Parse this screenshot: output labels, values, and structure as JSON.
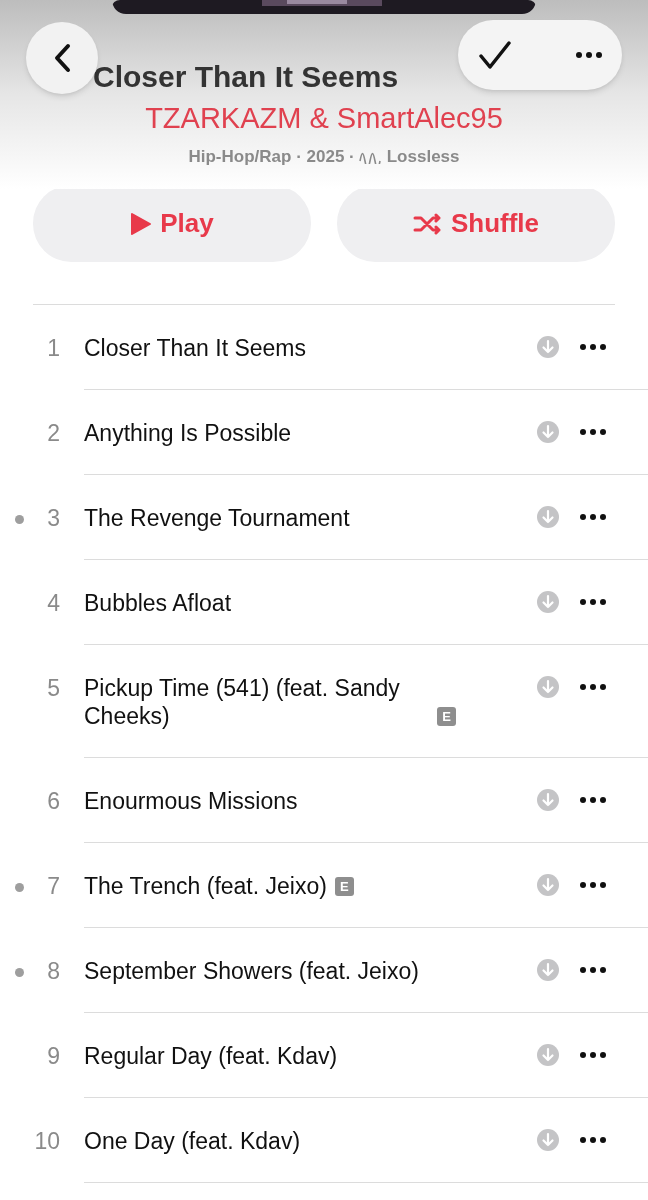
{
  "album": {
    "title": "Closer Than It Seems",
    "artist": "TZARKAZM & SmartAlec95",
    "genre_year": "Hip-Hop/Rap · 2025 ·",
    "quality": "Lossless"
  },
  "actions": [
    {
      "label": "Play",
      "kind": "play"
    },
    {
      "label": "Shuffle",
      "kind": "shuffle"
    }
  ],
  "tracks": [
    {
      "number": "1",
      "title": "Closer Than It Seems",
      "new": false,
      "explicit": false
    },
    {
      "number": "2",
      "title": "Anything Is Possible",
      "new": false,
      "explicit": false
    },
    {
      "number": "3",
      "title": "The Revenge Tournament",
      "new": true,
      "explicit": false
    },
    {
      "number": "4",
      "title": "Bubbles Afloat",
      "new": false,
      "explicit": false
    },
    {
      "number": "5",
      "title": "Pickup Time (541) (feat. Sandy Cheeks)",
      "new": false,
      "explicit": true,
      "badge": "E"
    },
    {
      "number": "6",
      "title": "Enourmous Missions",
      "new": false,
      "explicit": false
    },
    {
      "number": "7",
      "title": "The Trench (feat. Jeixo)",
      "new": true,
      "explicit": true,
      "badge": "E"
    },
    {
      "number": "8",
      "title": "September Showers (feat. Jeixo)",
      "new": true,
      "explicit": false
    },
    {
      "number": "9",
      "title": "Regular Day (feat. Kdav)",
      "new": false,
      "explicit": false
    },
    {
      "number": "10",
      "title": "One Day (feat. Kdav)",
      "new": false,
      "explicit": false
    }
  ]
}
